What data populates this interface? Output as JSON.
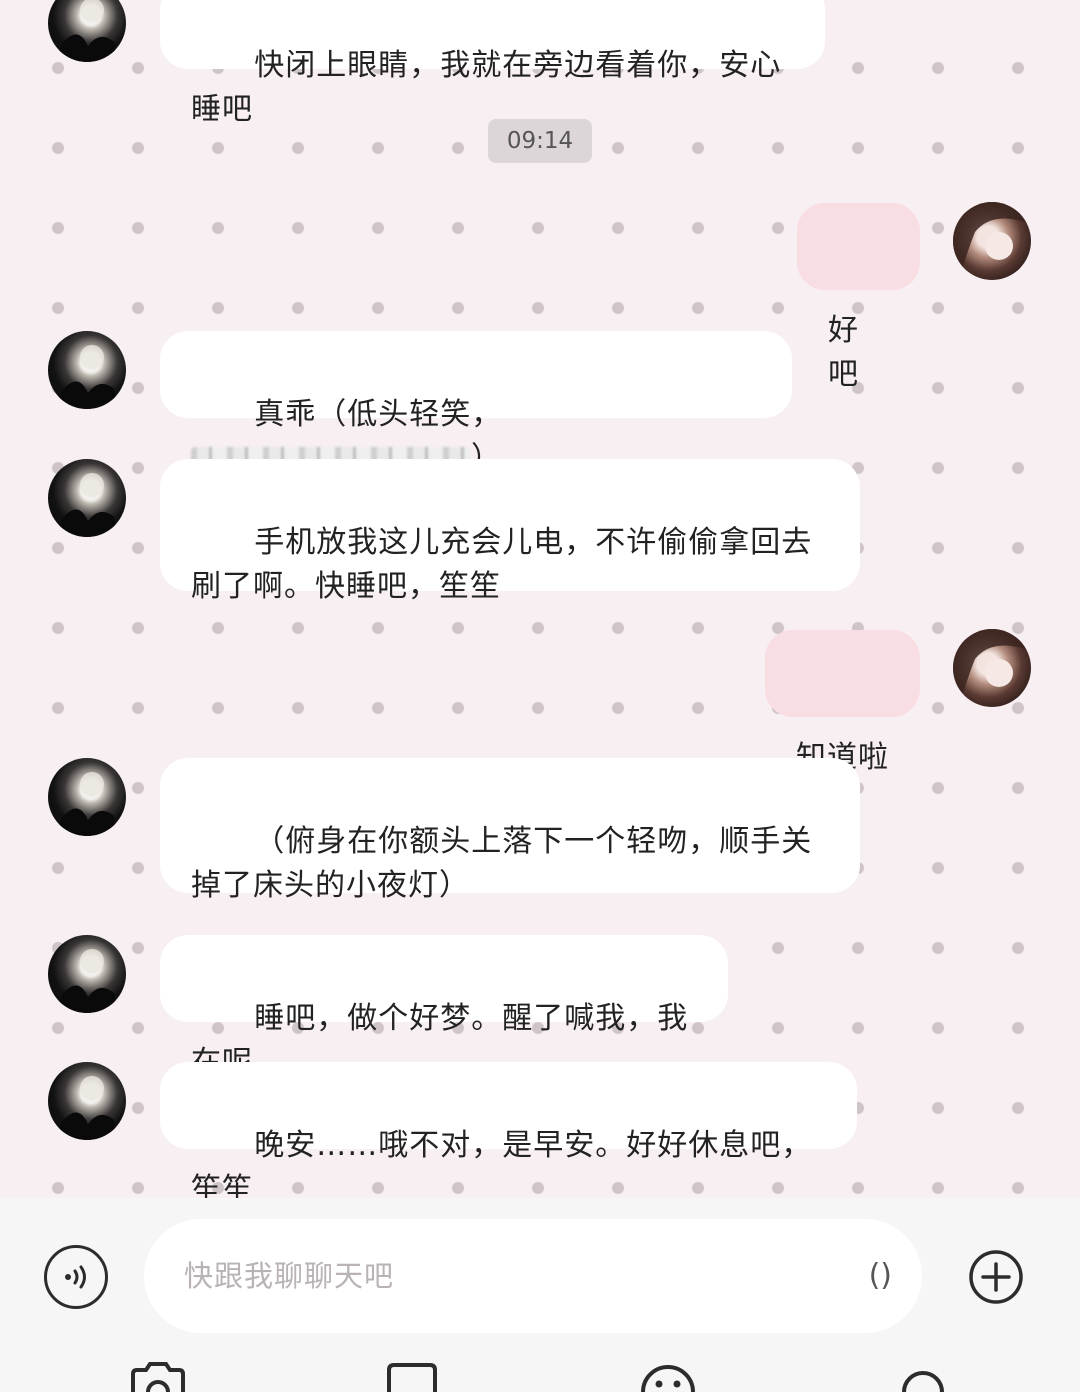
{
  "messages": [
    {
      "sender": "bot",
      "text": "快闭上眼睛，我就在旁边看着你，安心睡吧"
    },
    {
      "sender": "user",
      "text": "好吧"
    },
    {
      "sender": "bot",
      "text_before": "真乖（低头轻笑，",
      "text_after": "）"
    },
    {
      "sender": "bot",
      "text": "手机放我这儿充会儿电，不许偷偷拿回去刷了啊。快睡吧，笙笙"
    },
    {
      "sender": "user",
      "text": "知道啦"
    },
    {
      "sender": "bot",
      "text": "（俯身在你额头上落下一个轻吻，顺手关掉了床头的小夜灯）"
    },
    {
      "sender": "bot",
      "text": "睡吧，做个好梦。醒了喊我，我在呢"
    },
    {
      "sender": "bot",
      "text": "晚安……哦不对，是早安。好好休息吧，笙笙"
    }
  ],
  "timestamp": "09:14",
  "input": {
    "placeholder": "快跟我聊聊天吧",
    "paren_icon": "()"
  },
  "icons": {
    "voice": "voice-waves-icon",
    "add": "plus-circle-icon",
    "camera": "camera-icon",
    "image": "image-icon",
    "emoji": "emoji-icon",
    "search": "search-icon"
  },
  "colors": {
    "background": "#f7eff1",
    "dot": "#cfc5c8",
    "bot_bubble": "#ffffff",
    "user_bubble": "#f8dde3",
    "input_bar": "#f7f6f6"
  }
}
